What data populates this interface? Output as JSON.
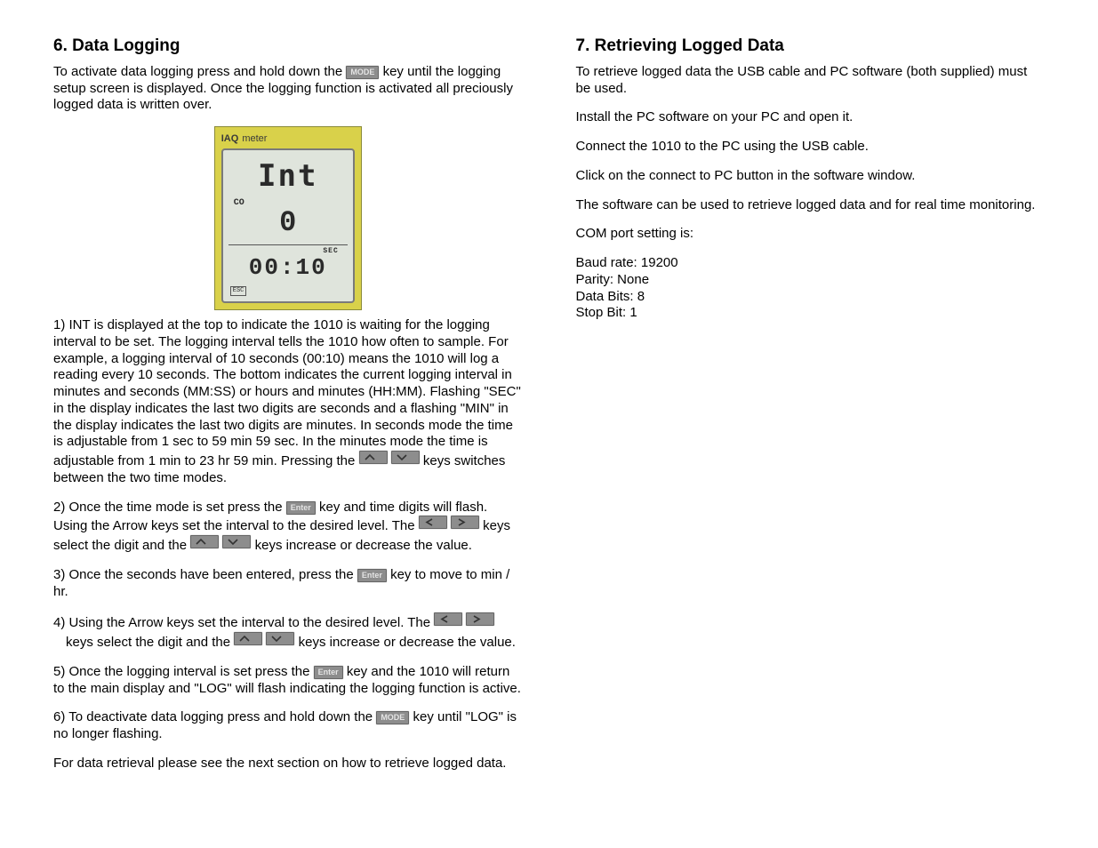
{
  "left": {
    "heading": "6. Data Logging",
    "intro_a": "To activate data logging press and hold down the ",
    "intro_b": " key until the logging setup screen is displayed. Once the logging function is activated all preciously logged data is written over.",
    "mode_label": "MODE",
    "enter_label": "Enter",
    "device": {
      "brand": "IAQ",
      "meter": "meter",
      "row1": "Int",
      "co": "CO",
      "row2": "0",
      "sec": "SEC",
      "row3": "00:10",
      "esc": "ESC"
    },
    "step1_a": "1) INT is displayed at the top to indicate the 1010 is waiting for the logging interval to be set. The logging interval tells the 1010 how often to sample. For example, a logging interval of 10 seconds (00:10) means the 1010 will log a reading every 10 seconds. The bottom indicates the current logging interval in minutes and seconds (MM:SS) or hours and minutes (HH:MM). Flashing \"SEC\" in the display indicates the last two digits are seconds and a flashing \"MIN\" in the display indicates the last two digits are minutes. In seconds mode the time is adjustable from 1 sec to 59 min 59 sec. In the minutes mode the time is adjustable from 1 min to 23 hr 59 min. Pressing the ",
    "step1_b": " keys switches between the two time modes.",
    "step2_a": "2) Once the time mode is set press the ",
    "step2_b": " key and time digits will flash. Using the Arrow keys set the interval to the desired level. The ",
    "step2_c": " keys select the digit and the ",
    "step2_d": " keys increase or decrease the value.",
    "step3_a": "3) Once the seconds have been entered, press the ",
    "step3_b": " key to move to min / hr.",
    "step4_a": "4) Using the Arrow keys set the interval to the desired level. The ",
    "step4_b": " keys select the digit and the ",
    "step4_c": " keys increase or decrease the value.",
    "step5_a": "5) Once the logging interval is set press the ",
    "step5_b": " key and the 1010 will return to the main display and \"LOG\" will flash indicating the logging function is active.",
    "step6_a": "6) To deactivate data logging press and hold down the ",
    "step6_b": " key until \"LOG\" is no longer flashing.",
    "footer": "For data retrieval please see the next section on how to retrieve logged data."
  },
  "right": {
    "heading": "7. Retrieving Logged Data",
    "p1": "To retrieve logged data the USB cable and PC software (both supplied) must be used.",
    "p2": "Install the PC software on your PC and open it.",
    "p3": "Connect the 1010 to the PC using the USB cable.",
    "p4": "Click on the connect to PC button in the software window.",
    "p5": "The software can be used to retrieve logged data and for real time monitoring.",
    "p6": "COM port setting is:",
    "settings": {
      "baud": "Baud rate: 19200",
      "parity": "Parity: None",
      "databits": "Data Bits: 8",
      "stopbit": "Stop Bit: 1"
    }
  }
}
